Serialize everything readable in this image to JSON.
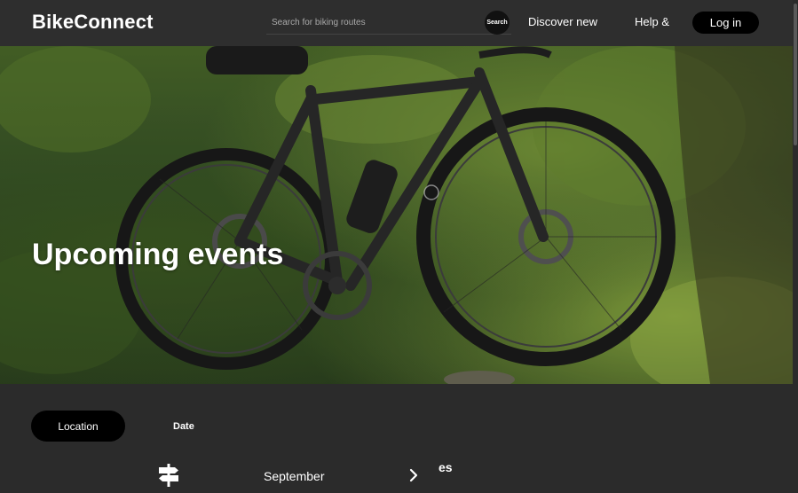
{
  "header": {
    "logo": "BikeConnect",
    "search": {
      "placeholder": "Search for biking routes",
      "button_label": "Search"
    },
    "nav": {
      "discover": "Discover new",
      "help": "Help &"
    },
    "login_label": "Log in"
  },
  "hero": {
    "title": "Upcoming events"
  },
  "filters": {
    "tabs": {
      "location": "Location",
      "date": "Date"
    },
    "month": "September",
    "partial_heading": "es"
  },
  "icons": {
    "signpost": "signpost-icon",
    "chevron": "chevron-right-icon"
  },
  "colors": {
    "header_bg": "#2e2e2e",
    "page_bg": "#2b2b2b",
    "button_bg": "#000000",
    "text": "#ffffff"
  }
}
